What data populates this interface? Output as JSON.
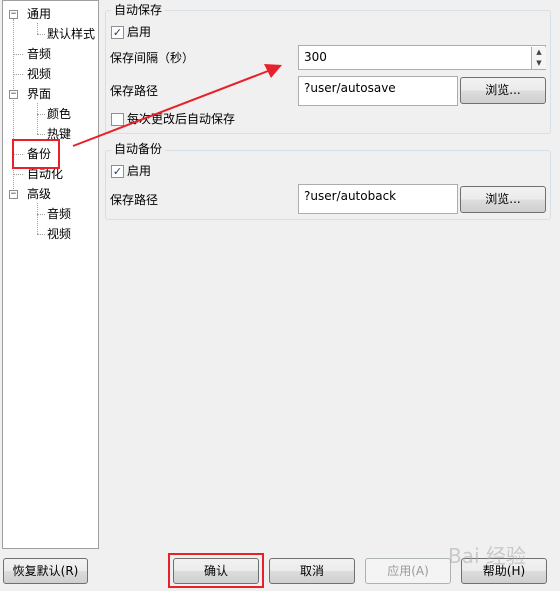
{
  "tree": {
    "general": "通用",
    "default_style": "默认样式",
    "audio": "音频",
    "video": "视频",
    "interface": "界面",
    "color": "颜色",
    "hotkeys": "热键",
    "backup": "备份",
    "automation": "自动化",
    "advanced": "高级",
    "adv_audio": "音频",
    "adv_video": "视频"
  },
  "autosave": {
    "title": "自动保存",
    "enable_label": "启用",
    "enable_checked": true,
    "interval_label": "保存间隔（秒）",
    "interval_value": "300",
    "path_label": "保存路径",
    "path_value": "?user/autosave",
    "browse_label": "浏览...",
    "on_change_label": "每次更改后自动保存",
    "on_change_checked": false
  },
  "autobackup": {
    "title": "自动备份",
    "enable_label": "启用",
    "enable_checked": true,
    "path_label": "保存路径",
    "path_value": "?user/autoback",
    "browse_label": "浏览..."
  },
  "footer": {
    "restore_label": "恢复默认(R)",
    "ok_label": "确认",
    "cancel_label": "取消",
    "apply_label": "应用(A)",
    "help_label": "帮助(H)"
  },
  "watermark": "Bai 经验",
  "colors": {
    "highlight": "#e8202a",
    "arrow": "#e8202a"
  }
}
